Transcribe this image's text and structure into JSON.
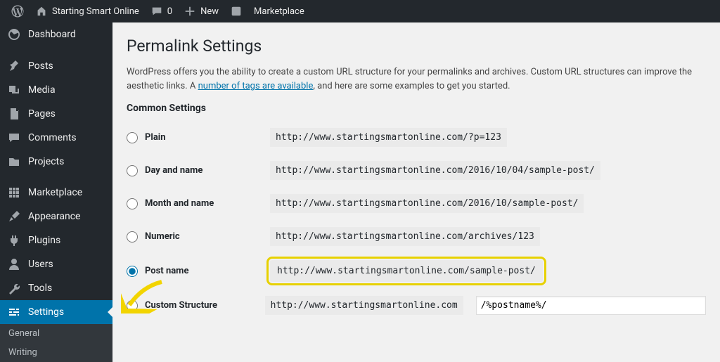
{
  "adminbar": {
    "site_name": "Starting Smart Online",
    "comment_count": "0",
    "new_label": "New",
    "marketplace_label": "Marketplace"
  },
  "sidebar": {
    "items": [
      {
        "id": "dashboard",
        "label": "Dashboard"
      },
      {
        "id": "posts",
        "label": "Posts"
      },
      {
        "id": "media",
        "label": "Media"
      },
      {
        "id": "pages",
        "label": "Pages"
      },
      {
        "id": "comments",
        "label": "Comments"
      },
      {
        "id": "projects",
        "label": "Projects"
      },
      {
        "id": "marketplace",
        "label": "Marketplace"
      },
      {
        "id": "appearance",
        "label": "Appearance"
      },
      {
        "id": "plugins",
        "label": "Plugins"
      },
      {
        "id": "users",
        "label": "Users"
      },
      {
        "id": "tools",
        "label": "Tools"
      },
      {
        "id": "settings",
        "label": "Settings"
      }
    ],
    "submenu": {
      "items": [
        {
          "id": "general",
          "label": "General"
        },
        {
          "id": "writing",
          "label": "Writing"
        }
      ]
    }
  },
  "page": {
    "title": "Permalink Settings",
    "desc_prefix": "WordPress offers you the ability to create a custom URL structure for your permalinks and archives. Custom URL structures can improve the aesthetic links. A ",
    "desc_link": "number of tags are available",
    "desc_suffix": ", and here are some examples to get you started.",
    "section_heading": "Common Settings"
  },
  "options": {
    "plain": {
      "label": "Plain",
      "url": "http://www.startingsmartonline.com/?p=123"
    },
    "dayname": {
      "label": "Day and name",
      "url": "http://www.startingsmartonline.com/2016/10/04/sample-post/"
    },
    "monthname": {
      "label": "Month and name",
      "url": "http://www.startingsmartonline.com/2016/10/sample-post/"
    },
    "numeric": {
      "label": "Numeric",
      "url": "http://www.startingsmartonline.com/archives/123"
    },
    "postname": {
      "label": "Post name",
      "url": "http://www.startingsmartonline.com/sample-post/"
    },
    "custom": {
      "label": "Custom Structure",
      "url_prefix": "http://www.startingsmartonline.com",
      "value": "/%postname%/"
    }
  },
  "colors": {
    "accent": "#0073aa",
    "highlight": "#e7d100"
  }
}
